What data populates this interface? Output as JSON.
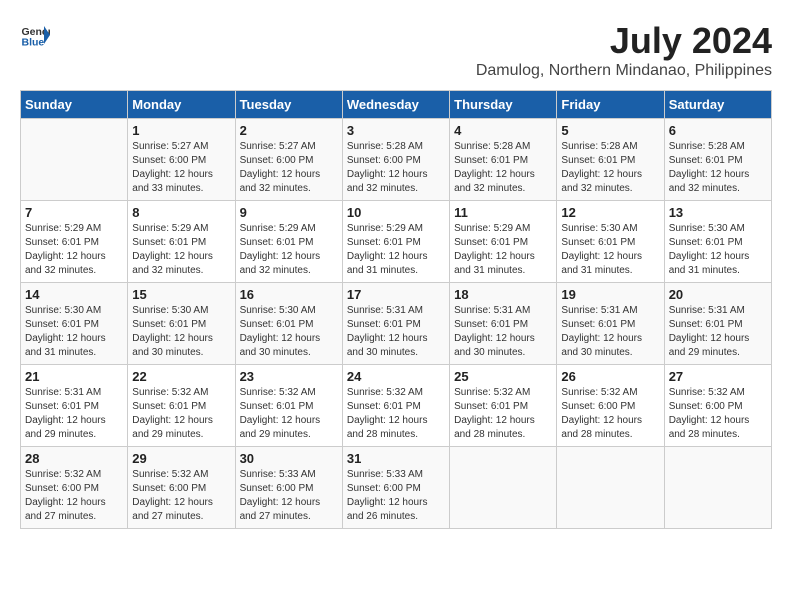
{
  "logo": {
    "general": "General",
    "blue": "Blue"
  },
  "title": {
    "month_year": "July 2024",
    "location": "Damulog, Northern Mindanao, Philippines"
  },
  "days_of_week": [
    "Sunday",
    "Monday",
    "Tuesday",
    "Wednesday",
    "Thursday",
    "Friday",
    "Saturday"
  ],
  "weeks": [
    [
      {
        "day": "",
        "sunrise": "",
        "sunset": "",
        "daylight": ""
      },
      {
        "day": "1",
        "sunrise": "Sunrise: 5:27 AM",
        "sunset": "Sunset: 6:00 PM",
        "daylight": "Daylight: 12 hours and 33 minutes."
      },
      {
        "day": "2",
        "sunrise": "Sunrise: 5:27 AM",
        "sunset": "Sunset: 6:00 PM",
        "daylight": "Daylight: 12 hours and 32 minutes."
      },
      {
        "day": "3",
        "sunrise": "Sunrise: 5:28 AM",
        "sunset": "Sunset: 6:00 PM",
        "daylight": "Daylight: 12 hours and 32 minutes."
      },
      {
        "day": "4",
        "sunrise": "Sunrise: 5:28 AM",
        "sunset": "Sunset: 6:01 PM",
        "daylight": "Daylight: 12 hours and 32 minutes."
      },
      {
        "day": "5",
        "sunrise": "Sunrise: 5:28 AM",
        "sunset": "Sunset: 6:01 PM",
        "daylight": "Daylight: 12 hours and 32 minutes."
      },
      {
        "day": "6",
        "sunrise": "Sunrise: 5:28 AM",
        "sunset": "Sunset: 6:01 PM",
        "daylight": "Daylight: 12 hours and 32 minutes."
      }
    ],
    [
      {
        "day": "7",
        "sunrise": "Sunrise: 5:29 AM",
        "sunset": "Sunset: 6:01 PM",
        "daylight": "Daylight: 12 hours and 32 minutes."
      },
      {
        "day": "8",
        "sunrise": "Sunrise: 5:29 AM",
        "sunset": "Sunset: 6:01 PM",
        "daylight": "Daylight: 12 hours and 32 minutes."
      },
      {
        "day": "9",
        "sunrise": "Sunrise: 5:29 AM",
        "sunset": "Sunset: 6:01 PM",
        "daylight": "Daylight: 12 hours and 32 minutes."
      },
      {
        "day": "10",
        "sunrise": "Sunrise: 5:29 AM",
        "sunset": "Sunset: 6:01 PM",
        "daylight": "Daylight: 12 hours and 31 minutes."
      },
      {
        "day": "11",
        "sunrise": "Sunrise: 5:29 AM",
        "sunset": "Sunset: 6:01 PM",
        "daylight": "Daylight: 12 hours and 31 minutes."
      },
      {
        "day": "12",
        "sunrise": "Sunrise: 5:30 AM",
        "sunset": "Sunset: 6:01 PM",
        "daylight": "Daylight: 12 hours and 31 minutes."
      },
      {
        "day": "13",
        "sunrise": "Sunrise: 5:30 AM",
        "sunset": "Sunset: 6:01 PM",
        "daylight": "Daylight: 12 hours and 31 minutes."
      }
    ],
    [
      {
        "day": "14",
        "sunrise": "Sunrise: 5:30 AM",
        "sunset": "Sunset: 6:01 PM",
        "daylight": "Daylight: 12 hours and 31 minutes."
      },
      {
        "day": "15",
        "sunrise": "Sunrise: 5:30 AM",
        "sunset": "Sunset: 6:01 PM",
        "daylight": "Daylight: 12 hours and 30 minutes."
      },
      {
        "day": "16",
        "sunrise": "Sunrise: 5:30 AM",
        "sunset": "Sunset: 6:01 PM",
        "daylight": "Daylight: 12 hours and 30 minutes."
      },
      {
        "day": "17",
        "sunrise": "Sunrise: 5:31 AM",
        "sunset": "Sunset: 6:01 PM",
        "daylight": "Daylight: 12 hours and 30 minutes."
      },
      {
        "day": "18",
        "sunrise": "Sunrise: 5:31 AM",
        "sunset": "Sunset: 6:01 PM",
        "daylight": "Daylight: 12 hours and 30 minutes."
      },
      {
        "day": "19",
        "sunrise": "Sunrise: 5:31 AM",
        "sunset": "Sunset: 6:01 PM",
        "daylight": "Daylight: 12 hours and 30 minutes."
      },
      {
        "day": "20",
        "sunrise": "Sunrise: 5:31 AM",
        "sunset": "Sunset: 6:01 PM",
        "daylight": "Daylight: 12 hours and 29 minutes."
      }
    ],
    [
      {
        "day": "21",
        "sunrise": "Sunrise: 5:31 AM",
        "sunset": "Sunset: 6:01 PM",
        "daylight": "Daylight: 12 hours and 29 minutes."
      },
      {
        "day": "22",
        "sunrise": "Sunrise: 5:32 AM",
        "sunset": "Sunset: 6:01 PM",
        "daylight": "Daylight: 12 hours and 29 minutes."
      },
      {
        "day": "23",
        "sunrise": "Sunrise: 5:32 AM",
        "sunset": "Sunset: 6:01 PM",
        "daylight": "Daylight: 12 hours and 29 minutes."
      },
      {
        "day": "24",
        "sunrise": "Sunrise: 5:32 AM",
        "sunset": "Sunset: 6:01 PM",
        "daylight": "Daylight: 12 hours and 28 minutes."
      },
      {
        "day": "25",
        "sunrise": "Sunrise: 5:32 AM",
        "sunset": "Sunset: 6:01 PM",
        "daylight": "Daylight: 12 hours and 28 minutes."
      },
      {
        "day": "26",
        "sunrise": "Sunrise: 5:32 AM",
        "sunset": "Sunset: 6:00 PM",
        "daylight": "Daylight: 12 hours and 28 minutes."
      },
      {
        "day": "27",
        "sunrise": "Sunrise: 5:32 AM",
        "sunset": "Sunset: 6:00 PM",
        "daylight": "Daylight: 12 hours and 28 minutes."
      }
    ],
    [
      {
        "day": "28",
        "sunrise": "Sunrise: 5:32 AM",
        "sunset": "Sunset: 6:00 PM",
        "daylight": "Daylight: 12 hours and 27 minutes."
      },
      {
        "day": "29",
        "sunrise": "Sunrise: 5:32 AM",
        "sunset": "Sunset: 6:00 PM",
        "daylight": "Daylight: 12 hours and 27 minutes."
      },
      {
        "day": "30",
        "sunrise": "Sunrise: 5:33 AM",
        "sunset": "Sunset: 6:00 PM",
        "daylight": "Daylight: 12 hours and 27 minutes."
      },
      {
        "day": "31",
        "sunrise": "Sunrise: 5:33 AM",
        "sunset": "Sunset: 6:00 PM",
        "daylight": "Daylight: 12 hours and 26 minutes."
      },
      {
        "day": "",
        "sunrise": "",
        "sunset": "",
        "daylight": ""
      },
      {
        "day": "",
        "sunrise": "",
        "sunset": "",
        "daylight": ""
      },
      {
        "day": "",
        "sunrise": "",
        "sunset": "",
        "daylight": ""
      }
    ]
  ]
}
